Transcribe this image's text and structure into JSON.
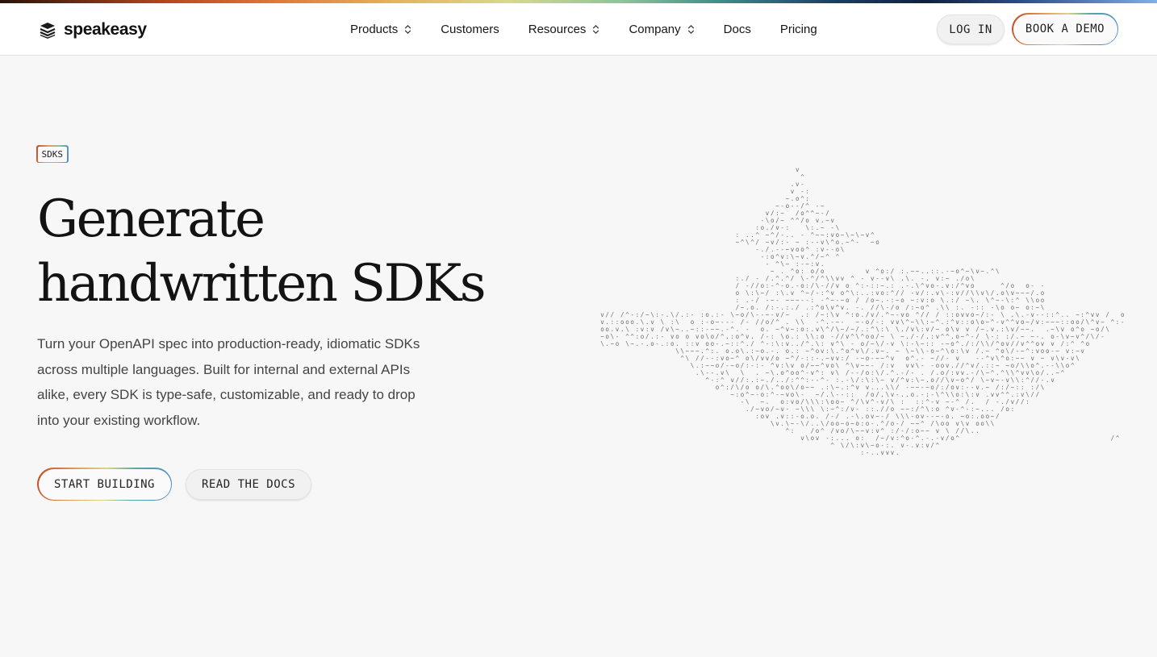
{
  "brand": {
    "name": "speakeasy",
    "logo_icon": "stacked-layers-icon"
  },
  "nav": {
    "items": [
      {
        "label": "Products",
        "has_dropdown": true
      },
      {
        "label": "Customers",
        "has_dropdown": false
      },
      {
        "label": "Resources",
        "has_dropdown": true
      },
      {
        "label": "Company",
        "has_dropdown": true
      },
      {
        "label": "Docs",
        "has_dropdown": false
      },
      {
        "label": "Pricing",
        "has_dropdown": false
      }
    ]
  },
  "header_actions": {
    "login_label": "LOG IN",
    "demo_label": "BOOK A DEMO"
  },
  "hero": {
    "tag": "SDKS",
    "headline_line1": "Generate",
    "headline_line2": "handwritten SDKs",
    "description": "Turn your OpenAPI spec into production-ready, idiomatic SDKs across multiple languages. Built for internal and external APIs alike, every SDK is type-safe, customizable, and ready to drop into your existing workflow.",
    "primary_cta": "START BUILDING",
    "secondary_cta": "READ THE DOCS"
  },
  "illustration": {
    "name": "ascii-ship-art",
    "glyphs": ".:-^~v/\\o",
    "ink_color": "#6b6b6b"
  },
  "colors": {
    "page_bg": "#f7f7f7",
    "header_bg": "#ffffff",
    "text_primary": "#161616",
    "text_secondary": "#444444",
    "gradient_start": "#c44a26",
    "gradient_mid": "#d9d58a",
    "gradient_end": "#4d86d4"
  }
}
